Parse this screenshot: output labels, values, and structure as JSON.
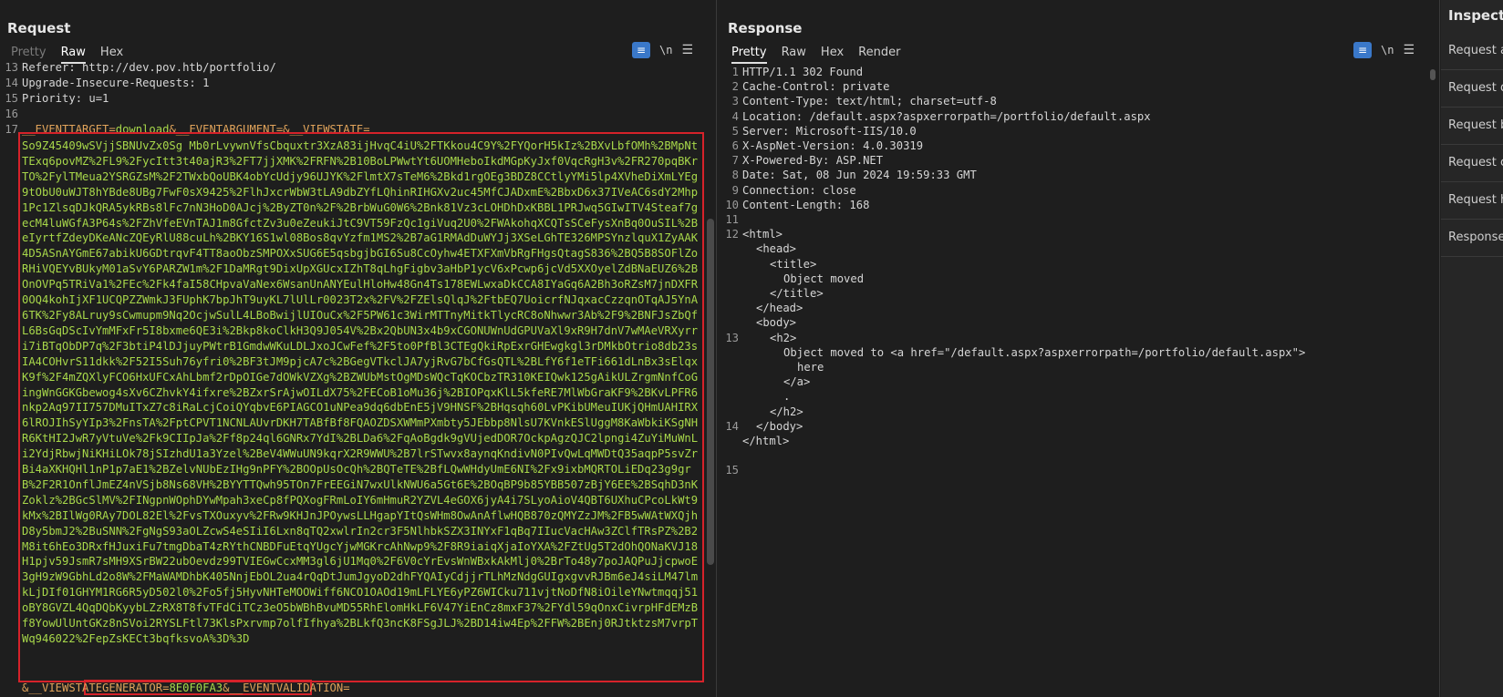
{
  "request": {
    "title": "Request",
    "tabs": [
      "Pretty",
      "Raw",
      "Hex"
    ],
    "active_tab": "Raw",
    "icons": {
      "wrap": "wrap-lines-icon",
      "newline": "\\n",
      "menu": "menu-icon"
    },
    "lines": [
      {
        "n": "13",
        "text": "Referer: http://dev.pov.htb/portfolio/"
      },
      {
        "n": "14",
        "text": "Upgrade-Insecure-Requests: 1"
      },
      {
        "n": "15",
        "text": "Priority: u=1"
      },
      {
        "n": "16",
        "text": ""
      }
    ],
    "line17": {
      "n": "17",
      "p1": "__EVENTTARGET=",
      "v1": "download",
      "p2": "&__EVENTARGUMENT=&__VIEWSTATE="
    },
    "viewstate": "So9Z45409wSVjjSBNUvZx0Sg Mb0rLvywnVfsCbquxtr3XzA83ijHvqC4iU%2FTKkou4C9Y%2FYQorH5kIz%2BXvLbfOMh%2BMpNtTExq6povMZ%2FL9%2FycItt3t40ajR3%2FT7jjXMK%2FRFN%2B10BoLPWwtYt6UOMHeboIkdMGpKyJxf0VqcRgH3v%2FR270pqBKrTO%2FylTMeua2YSRGZsM%2F2TWxbQoUBK4obYcUdjy96UJYK%2FlmtX7sTeM6%2Bkd1rgOEg3BDZ8CCtlyYMi5lp4XVheDiXmLYEg9tObU0uWJT8hYBde8UBg7FwF0sX9425%2FlhJxcrWbW3tLA9dbZYfLQhinRIHGXv2uc45MfCJADxmE%2BbxD6x37IVeAC6sdY2Mhp1Pc1ZlsqDJkQRA5ykRBs8lFc7nN3HoD0AJcj%2ByZT0n%2F%2BrbWuG0W6%2Bnk81Vz3cLOHDhDxKBBL1PRJwq5GIwITV4Steaf7gecM4luWGfA3P64s%2FZhVfeEVnTAJ1m8GfctZv3u0eZeukiJtC9VT59FzQc1giVuq2U0%2FWAkohqXCQTsSCeFysXnBq0OuSIL%2BeIyrtfZdeyDKeANcZQEyRlU88cuLh%2BKY16S1wl08Bos8qvYzfm1MS2%2B7aG1RMAdDuWYJj3XSeLGhTE326MPSYnzlquX1ZyAAK4D5ASnAYGmE67abikU6GDtrqvF4TT8aoObzSMPOXxSUG6E5qsbgjbGI6Su8CcOyhw4ETXFXmVbRgFHgsQtagS836%2BQ5B8SOFlZoRHiVQEYvBUkyM01aSvY6PARZW1m%2F1DaMRgt9DixUpXGUcxIZhT8qLhgFigbv3aHbP1ycV6xPcwp6jcVd5XXOyelZdBNaEUZ6%2BOnOVPq5TRiVa1%2FEc%2Fk4faI58CHpvaVaNex6WsanUnANYEulHloHw48Gn4Ts178EWLwxaDkCCA8IYaGq6A2Bh3oRZsM7jnDXFR0OQ4kohIjXF1UCQPZZWmkJ3FUphK7bpJhT9uyKL7lUlLr0023T2x%2FV%2FZElsQlqJ%2FtbEQ7UoicrfNJqxacCzzqnOTqAJ5YnA6TK%2Fy8ALruy9sCwmupm9Nq2OcjwSulL4LBoBwijlUIOuCx%2F5PW61c3WirMTTnyMitkTlycRC8oNhwwr3Ab%2F9%2BNFJsZbQfL6BsGqDScIvYmMFxFr5I8bxme6QE3i%2Bkp8koClkH3Q9J054V%2Bx2QbUN3x4b9xCGONUWnUdGPUVaXl9xR9H7dnV7wMAeVRXyrri7iBTqObDP7q%2F3btiP4lDJjuyPWtrB1GmdwWKuLDLJxoJCwFef%2F5to0PfBl3CTEgQkiRpExrGHEwgkgl3rDMkbOtrio8db23sIA4COHvrS11dkk%2F52I5Suh76yfri0%2BF3tJM9pjcA7c%2BGegVTkclJA7yjRvG7bCfGsQTL%2BLfY6f1eTFi661dLnBx3sElqxK9f%2F4mZQXlyFCO6HxUFCxAhLbmf2rDpOIGe7dOWkVZXg%2BZWUbMstOgMDsWQcTqKOCbzTR310KEIQwk125gAikULZrgmNnfCoGingWnGGKGbewog4sXv6CZhvkY4ifxre%2BZxrSrAjwOILdX75%2FECoB1oMu36j%2BIOPqxKlL5kfeRE7MlWbGraKF9%2BKvLPFR6nkp2Aq97II757DMuITxZ7c8iRaLcjCoiQYqbvE6PIAGCO1uNPea9dq6dbEnE5jV9HNSF%2BHqsqh60LvPKibUMeuIUKjQHmUAHIRX6lROJIhSyYIp3%2FnsTA%2FptCPVT1NCNLAUvrDKH7TABfBf8FQAOZDSXWMmPXmbty5JEbbp8NlsU7KVnkESlUggM8KaWbkiKSgNHR6KtHI2JwR7yVtuVe%2Fk9CIIpJa%2Ff8p24ql6GNRx7YdI%2BLDa6%2FqAoBgdk9gVUjedDOR7OckpAgzQJC2lpngi4ZuYiMuWnLi2YdjRbwjNiKHiLOk78jSIzhdU1a3Yzel%2BeV4WWuUN9kqrX2R9WWU%2B7lrSTwvx8aynqKndivN0PIvQwLqMWDtQ35aqpP5svZrBi4aXKHQHl1nP1p7aE1%2BZelvNUbEzIHg9nPFY%2BOOpUsOcQh%2BQTeTE%2BfLQwWHdyUmE6NI%2Fx9ixbMQRTOLiEDq23g9grB%2F2R1OnflJmEZ4nVSjb8Ns68VH%2BYYTTQwh95TOn7FrEEGiN7wxUlkNWU6a5Gt6E%2BOqBP9b85YBB507zBjY6EE%2BSqhD3nKZoklz%2BGcSlMV%2FINgpnWOphDYwMpah3xeCp8fPQXogFRmLoIY6mHmuR2YZVL4eGOX6jyA4i7SLyoAioV4QBT6UXhuCPcoLkWt9kMx%2BIlWg0RAy7DOL82El%2FvsTXOuxyv%2FRw9KHJnJPOywsLLHgapYItQsWHm8OwAnAflwHQB870zQMYZzJM%2FB5wWAtWXQjhD8y5bmJ2%2BuSNN%2FgNgS93aOLZcwS4eSIiI6Lxn8qTQ2xwlrIn2cr3F5NlhbkSZX3INYxF1qBq7IIucVacHAw3ZClfTRsPZ%2B2M8it6hEo3DRxfHJuxiFu7tmgDbaT4zRYthCNBDFuEtqYUgcYjwMGKrcAhNwp9%2F8R9iaiqXjaIoYXA%2FZtUg5T2dOhQONaKVJ18H1pjv59JsmR7sMH9XSrBW22ubOevdz99TVIEGwCcxMM3gl6jU1Mq0%2F6V0cYrEvsWnWBxkAkMlj0%2BrTo48y7poJAQPuJjcpwoE3gH9zW9GbhLd2o8W%2FMaWAMDhbK405NnjEbOL2ua4rQqDtJumJgyoD2dhFYQAIyCdjjrTLhMzNdgGUIgxgvvRJBm6eJ4siLM47lmkLjDIf01GHYM1RG6R5yD502l0%2Fo5fj5HyvNHTeMOOWiff6NCO1OAOd19mLFLYE6yPZ6WICku711vjtNoDfN8iOileYNwtmqqj51oBY8GVZL4QqDQbKyybLZzRX8T8fvTFdCiTCz3eO5bWBhBvuMD55RhElomHkLF6V47YiEnCz8mxF37%2FYdl59qOnxCivrpHFdEMzBf8YowUlUntGKz8nSVoi2RYSLFtl73KlsPxrvmp7olfIfhya%2BLkfQ3ncK8FSgJLJ%2BD14iw4Ep%2FFW%2BEnj0RJtktzsM7vrpTWq946022%2FepZsKECt3bqfksvoA%3D%3D",
    "tail": {
      "p1": "&__VIEWSTATEGENERATOR=",
      "v1": "8E0F0FA3",
      "p2": "&__EVENTVALIDATION="
    }
  },
  "response": {
    "title": "Response",
    "tabs": [
      "Pretty",
      "Raw",
      "Hex",
      "Render"
    ],
    "active_tab": "Pretty",
    "headers": [
      {
        "n": "1",
        "text": "HTTP/1.1 302 Found"
      },
      {
        "n": "2",
        "text": "Cache-Control: private"
      },
      {
        "n": "3",
        "text": "Content-Type: text/html; charset=utf-8"
      },
      {
        "n": "4",
        "text": "Location: /default.aspx?aspxerrorpath=/portfolio/default.aspx"
      },
      {
        "n": "5",
        "text": "Server: Microsoft-IIS/10.0"
      },
      {
        "n": "6",
        "text": "X-AspNet-Version: 4.0.30319"
      },
      {
        "n": "7",
        "text": "X-Powered-By: ASP.NET"
      },
      {
        "n": "8",
        "text": "Date: Sat, 08 Jun 2024 19:59:33 GMT"
      },
      {
        "n": "9",
        "text": "Connection: close"
      },
      {
        "n": "10",
        "text": "Content-Length: 168"
      },
      {
        "n": "11",
        "text": ""
      }
    ],
    "body": [
      {
        "n": "12",
        "indent": 0,
        "text": "<html>"
      },
      {
        "n": "",
        "indent": 1,
        "text": "<head>"
      },
      {
        "n": "",
        "indent": 2,
        "text": "<title>"
      },
      {
        "n": "",
        "indent": 3,
        "text": "Object moved"
      },
      {
        "n": "",
        "indent": 2,
        "text": "</title>"
      },
      {
        "n": "",
        "indent": 1,
        "text": "</head>"
      },
      {
        "n": "",
        "indent": 1,
        "text": "<body>"
      },
      {
        "n": "13",
        "indent": 2,
        "text": "<h2>"
      },
      {
        "n": "",
        "indent": 3,
        "text": "Object moved to <a href=\"/default.aspx?aspxerrorpath=/portfolio/default.aspx\">"
      },
      {
        "n": "",
        "indent": 4,
        "text": "here"
      },
      {
        "n": "",
        "indent": 3,
        "text": "</a>"
      },
      {
        "n": "",
        "indent": 3,
        "text": "."
      },
      {
        "n": "",
        "indent": 2,
        "text": "</h2>"
      },
      {
        "n": "14",
        "indent": 1,
        "text": "</body>"
      },
      {
        "n": "",
        "indent": 0,
        "text": "</html>"
      },
      {
        "n": "",
        "indent": 0,
        "text": ""
      },
      {
        "n": "15",
        "indent": 0,
        "text": ""
      }
    ]
  },
  "inspector": {
    "title": "Inspector",
    "items": [
      "Request attributes",
      "Request query parameters",
      "Request body parameters",
      "Request cookies",
      "Request headers",
      "Response headers"
    ]
  },
  "colors": {
    "accent": "#3a78c9",
    "highlight_border": "#d6222a",
    "param_value": "#a8d84a",
    "key_value": "#e0a35a"
  }
}
